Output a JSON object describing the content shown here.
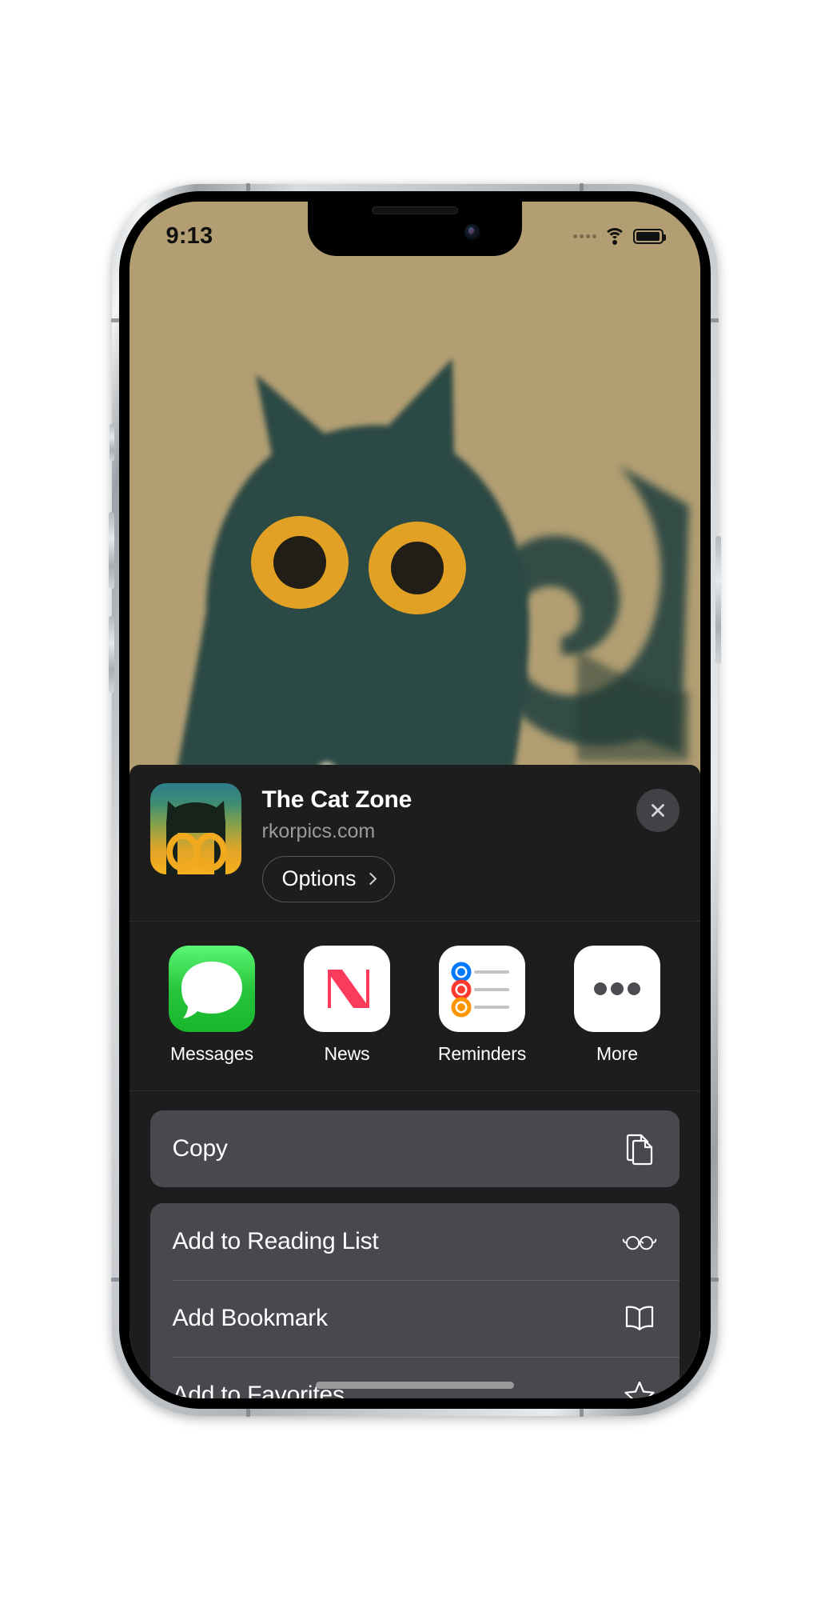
{
  "device": {
    "name": "iPhone",
    "orientation": "portrait"
  },
  "status_bar": {
    "time": "9:13",
    "signal_icon": "cellular-dots-icon",
    "wifi_icon": "wifi-icon",
    "battery_icon": "battery-full-icon"
  },
  "wallpaper": {
    "description": "illustration of a dark teal cat with yellow ring eyes on a tan background",
    "background_color": "#b39f73",
    "cat_color": "#1d3f3f",
    "eye_ring_color": "#e8a21c",
    "chest_color": "#d9d2bb"
  },
  "share_sheet": {
    "header": {
      "title": "The Cat Zone",
      "url": "rkorpics.com",
      "options_label": "Options",
      "options_chevron_icon": "chevron-right-icon",
      "close_icon": "close-icon",
      "site_icon": "cat-face-app-icon"
    },
    "apps": [
      {
        "label": "Messages",
        "icon": "messages-icon"
      },
      {
        "label": "News",
        "icon": "news-icon"
      },
      {
        "label": "Reminders",
        "icon": "reminders-icon"
      },
      {
        "label": "More",
        "icon": "more-ellipsis-icon"
      }
    ],
    "action_groups": [
      {
        "rows": [
          {
            "label": "Copy",
            "icon": "copy-documents-icon"
          }
        ]
      },
      {
        "rows": [
          {
            "label": "Add to Reading List",
            "icon": "glasses-icon"
          },
          {
            "label": "Add Bookmark",
            "icon": "book-open-icon"
          },
          {
            "label": "Add to Favorites",
            "icon": "star-outline-icon"
          }
        ]
      }
    ]
  },
  "colors": {
    "sheet_background": "#1d1d1d",
    "card_background": "#48484e",
    "accent_text": "#ffffff",
    "secondary_text": "#9a9a9e",
    "messages_green": "#27c53a",
    "news_red": "#fb3b5c",
    "reminder_blue": "#007aff",
    "reminder_red": "#ff3b30",
    "reminder_orange": "#ff9500"
  }
}
